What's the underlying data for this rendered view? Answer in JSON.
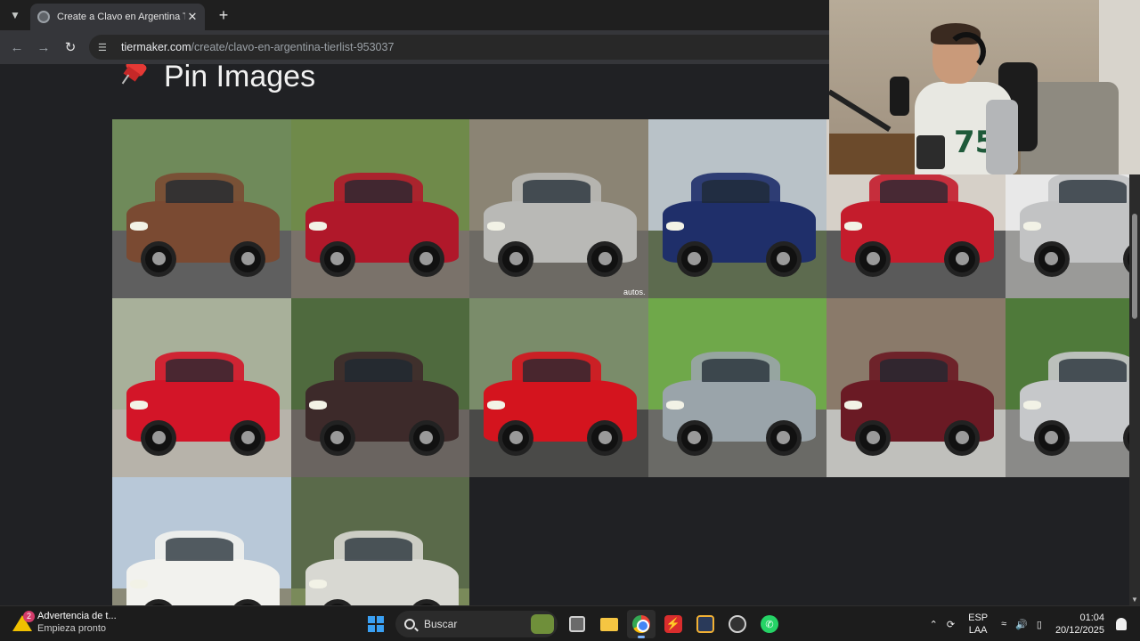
{
  "browser": {
    "tab": {
      "title": "Create a Clavo en Argentina Ti",
      "favicon": "globe-icon"
    },
    "address": {
      "host": "tiermaker.com",
      "path": "/create/clavo-en-argentina-tierlist-953037"
    }
  },
  "page": {
    "heading": "Pin Images",
    "heading_icon": "pushpin-icon",
    "tiles": [
      {
        "name": "brown-sedan",
        "body": "#7a4a32",
        "bg": "#6f8a5a",
        "ground": "#5f5f5f"
      },
      {
        "name": "red-hatchback",
        "body": "#b0182a",
        "bg": "#6f8a4a",
        "ground": "#7a726a"
      },
      {
        "name": "silver-hatchback",
        "body": "#b9b9b6",
        "bg": "#8b8474",
        "ground": "#6d6a64",
        "watermark": "autos."
      },
      {
        "name": "blue-compact",
        "body": "#1f2f6a",
        "bg": "#b9c2c8",
        "ground": "#5d6b4f"
      },
      {
        "name": "red-coupe",
        "body": "#c41c2c",
        "bg": "#d6d0c8",
        "ground": "#5a5a5a"
      },
      {
        "name": "silver-sedan",
        "body": "#c2c3c4",
        "bg": "#e8e8e8",
        "ground": "#9a9a98"
      },
      {
        "name": "red-neon",
        "body": "#d31528",
        "bg": "#a8b09a",
        "ground": "#b7b3aa"
      },
      {
        "name": "brown-citroen",
        "body": "#3d2a2a",
        "bg": "#4f6a3e",
        "ground": "#6a6460"
      },
      {
        "name": "red-sportscar",
        "body": "#d4141e",
        "bg": "#7a8c6a",
        "ground": "#4a4a48"
      },
      {
        "name": "silver-suv",
        "body": "#9aa4aa",
        "bg": "#6fa84a",
        "ground": "#6a6a66"
      },
      {
        "name": "maroon-wagon",
        "body": "#6a1a24",
        "bg": "#8a7a6a",
        "ground": "#c0c0bc"
      },
      {
        "name": "silver-chrysler",
        "body": "#c6c8ca",
        "bg": "#4f7a3a",
        "ground": "#8a8a88"
      },
      {
        "name": "white-gol",
        "body": "#f2f2ee",
        "bg": "#b8c8d8",
        "ground": "#8b8a78"
      },
      {
        "name": "white-sedan",
        "body": "#d8d8d2",
        "bg": "#5a6a4a",
        "ground": "#7a8a5a"
      }
    ]
  },
  "webcam": {
    "jersey_number": "75"
  },
  "taskbar": {
    "weather_title": "Advertencia de t...",
    "weather_subtitle": "Empieza pronto",
    "weather_badge": "2",
    "search_placeholder": "Buscar",
    "lang_line1": "ESP",
    "lang_line2": "LAA",
    "time": "01:04",
    "date": "20/12/2025"
  }
}
